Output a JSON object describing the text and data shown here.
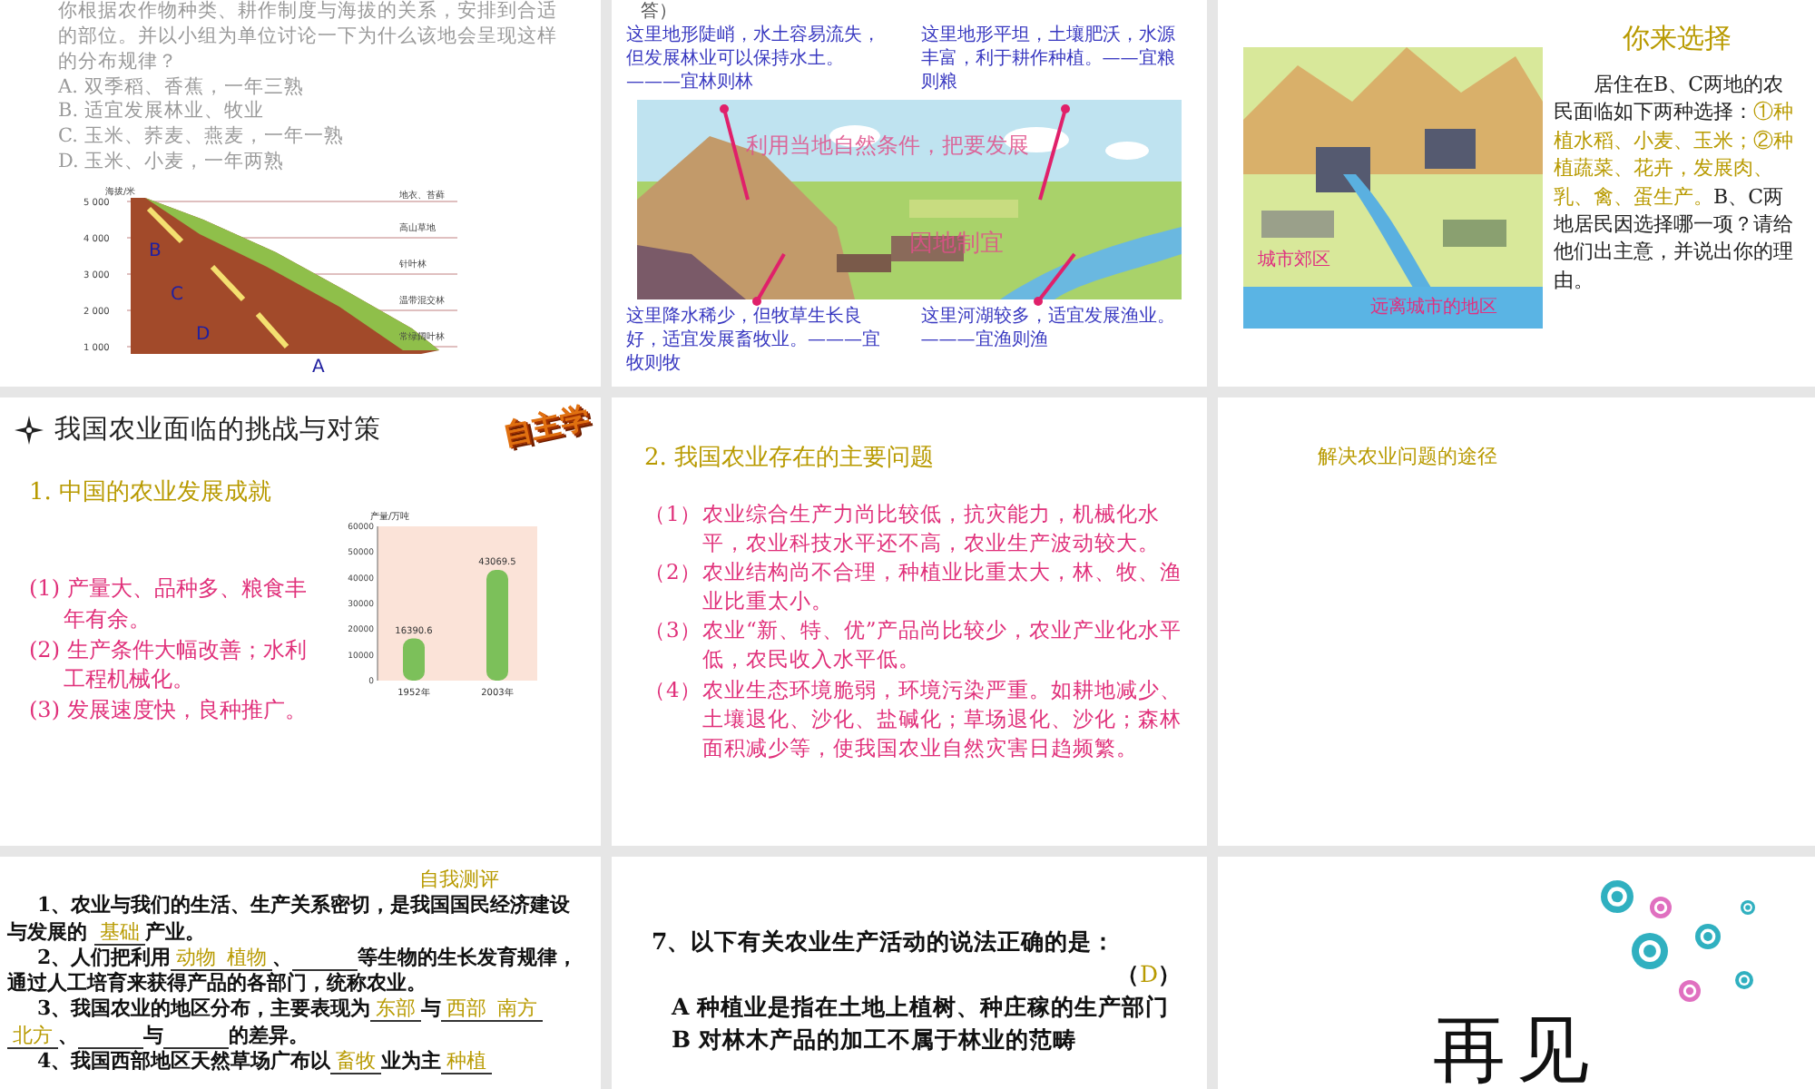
{
  "slides": [
    {
      "kind": "altitude",
      "question": "你根据农作物种类、耕作制度与海拔的关系，安排到合适的部位。并以小组为单位讨论一下为什么该地会呈现这样的分布规律？",
      "options": [
        "A. 双季稻、香蕉，一年三熟",
        "B. 适宜发展林业、牧业",
        "C. 玉米、荞麦、燕麦，一年一熟",
        "D. 玉米、小麦，一年两熟"
      ],
      "axis_title": "海拔/米",
      "ticks": [
        "5 000",
        "4 000",
        "3 000",
        "2 000",
        "1 000"
      ],
      "zones": [
        "地衣、苔藓",
        "高山草地",
        "针叶林",
        "温带混交林",
        "常绿阔叶林"
      ],
      "letters": [
        "B",
        "C",
        "D",
        "A"
      ]
    },
    {
      "kind": "landscape",
      "stub": "答）",
      "callouts_top": [
        "这里地形陡峭，水土容易流失，但发展林业可以保持水土。———宜林则林",
        "这里地形平坦，土壤肥沃，水源丰富，利于耕作种植。——宜粮则粮"
      ],
      "overlay": [
        "利用当地自然条件，把要发展",
        "因地制宜"
      ],
      "callouts_bottom": [
        "这里降水稀少，但牧草生长良好，适宜发展畜牧业。———宜牧则牧",
        "这里河湖较多，适宜发展渔业。———宜渔则渔"
      ]
    },
    {
      "kind": "choice",
      "title": "你来选择",
      "map_labels": [
        "城市郊区",
        "远离城市的地区"
      ],
      "intro": "居住在B、C两地的农民面临如下两种选择：",
      "options_text": "①种植水稻、小麦、玉米；②种植蔬菜、花卉，发展肉、乳、禽、蛋生产。",
      "question": "B、C两地居民因选择哪一项？请给他们出主意，并说出你的理由。"
    },
    {
      "kind": "achievements",
      "title": "我国农业面临的挑战与对策",
      "badge": "自主学",
      "subtitle": "1. 中国的农业发展成就",
      "items": [
        "(1) 产量大、品种多、粮食丰年有余。",
        "(2) 生产条件大幅改善；水利工程机械化。",
        "(3) 发展速度快，良种推广。"
      ],
      "chart_data": {
        "type": "bar",
        "ylabel": "产量/万吨",
        "categories": [
          "1952年",
          "2003年"
        ],
        "values": [
          16390.6,
          43069.5
        ],
        "ylim": [
          0,
          60000
        ],
        "yticks": [
          0,
          10000,
          20000,
          30000,
          40000,
          50000,
          60000
        ],
        "data_labels": true
      }
    },
    {
      "kind": "problems",
      "title": "2. 我国农业存在的主要问题",
      "items": [
        {
          "num": "（1）",
          "text": "农业综合生产力尚比较低，抗灾能力，机械化水平，农业科技水平还不高，农业生产波动较大。"
        },
        {
          "num": "（2）",
          "text": "农业结构尚不合理，种植业比重太大，林、牧、渔业比重太小。"
        },
        {
          "num": "（3）",
          "text": "农业“新、特、优”产品尚比较少，农业产业化水平低，农民收入水平低。"
        },
        {
          "num": "（4）",
          "text": "农业生态环境脆弱，环境污染严重。如耕地减少、土壤退化、沙化、盐碱化；草场退化、沙化；森林面积减少等，使我国农业自然灾害日趋频繁。"
        }
      ]
    },
    {
      "kind": "heading",
      "title": "解决农业问题的途径"
    },
    {
      "kind": "quiz",
      "title": "自我测评",
      "lines": [
        [
          {
            "kind": "text",
            "text": "1、农业与我们的生活、生产关系密切，是我国国民经济建设与发展的 "
          },
          {
            "kind": "answer",
            "text": "基础"
          },
          {
            "kind": "text",
            "text": "产业。"
          }
        ],
        [
          {
            "kind": "text",
            "text": "2、人们把利用"
          },
          {
            "kind": "answer",
            "text": "动物"
          },
          {
            "kind": "answer",
            "text": "植物"
          },
          {
            "kind": "text",
            "text": "、"
          },
          {
            "kind": "blank"
          },
          {
            "kind": "text",
            "text": "等生物的生长发育规律，通过人工培育来获得产品的各部门，统称农业。"
          }
        ],
        [
          {
            "kind": "text",
            "text": "3、我国农业的地区分布，主要表现为"
          },
          {
            "kind": "answer",
            "text": "东部"
          },
          {
            "kind": "text",
            "text": "与"
          },
          {
            "kind": "answer",
            "text": "西部"
          },
          {
            "kind": "answer",
            "text": "南方"
          },
          {
            "kind": "answer",
            "text": "北方"
          },
          {
            "kind": "text",
            "text": "、"
          },
          {
            "kind": "blank"
          },
          {
            "kind": "text",
            "text": "与"
          },
          {
            "kind": "blank"
          },
          {
            "kind": "text",
            "text": "的差异。"
          }
        ],
        [
          {
            "kind": "text",
            "text": "4、我国西部地区天然草场广布以"
          },
          {
            "kind": "answer",
            "text": "畜牧"
          },
          {
            "kind": "text",
            "text": "业为主"
          },
          {
            "kind": "answer",
            "text": "种植"
          }
        ]
      ]
    },
    {
      "kind": "mcq",
      "question": "7、以下有关农业生产活动的说法正确的是：",
      "brackets": [
        "（",
        "）"
      ],
      "answer": "D",
      "options": [
        "A 种植业是指在土地上植树、种庄稼的生产部门",
        "B 对林木产品的加工不属于林业的范畴"
      ]
    },
    {
      "kind": "farewell",
      "text": "再见"
    }
  ]
}
